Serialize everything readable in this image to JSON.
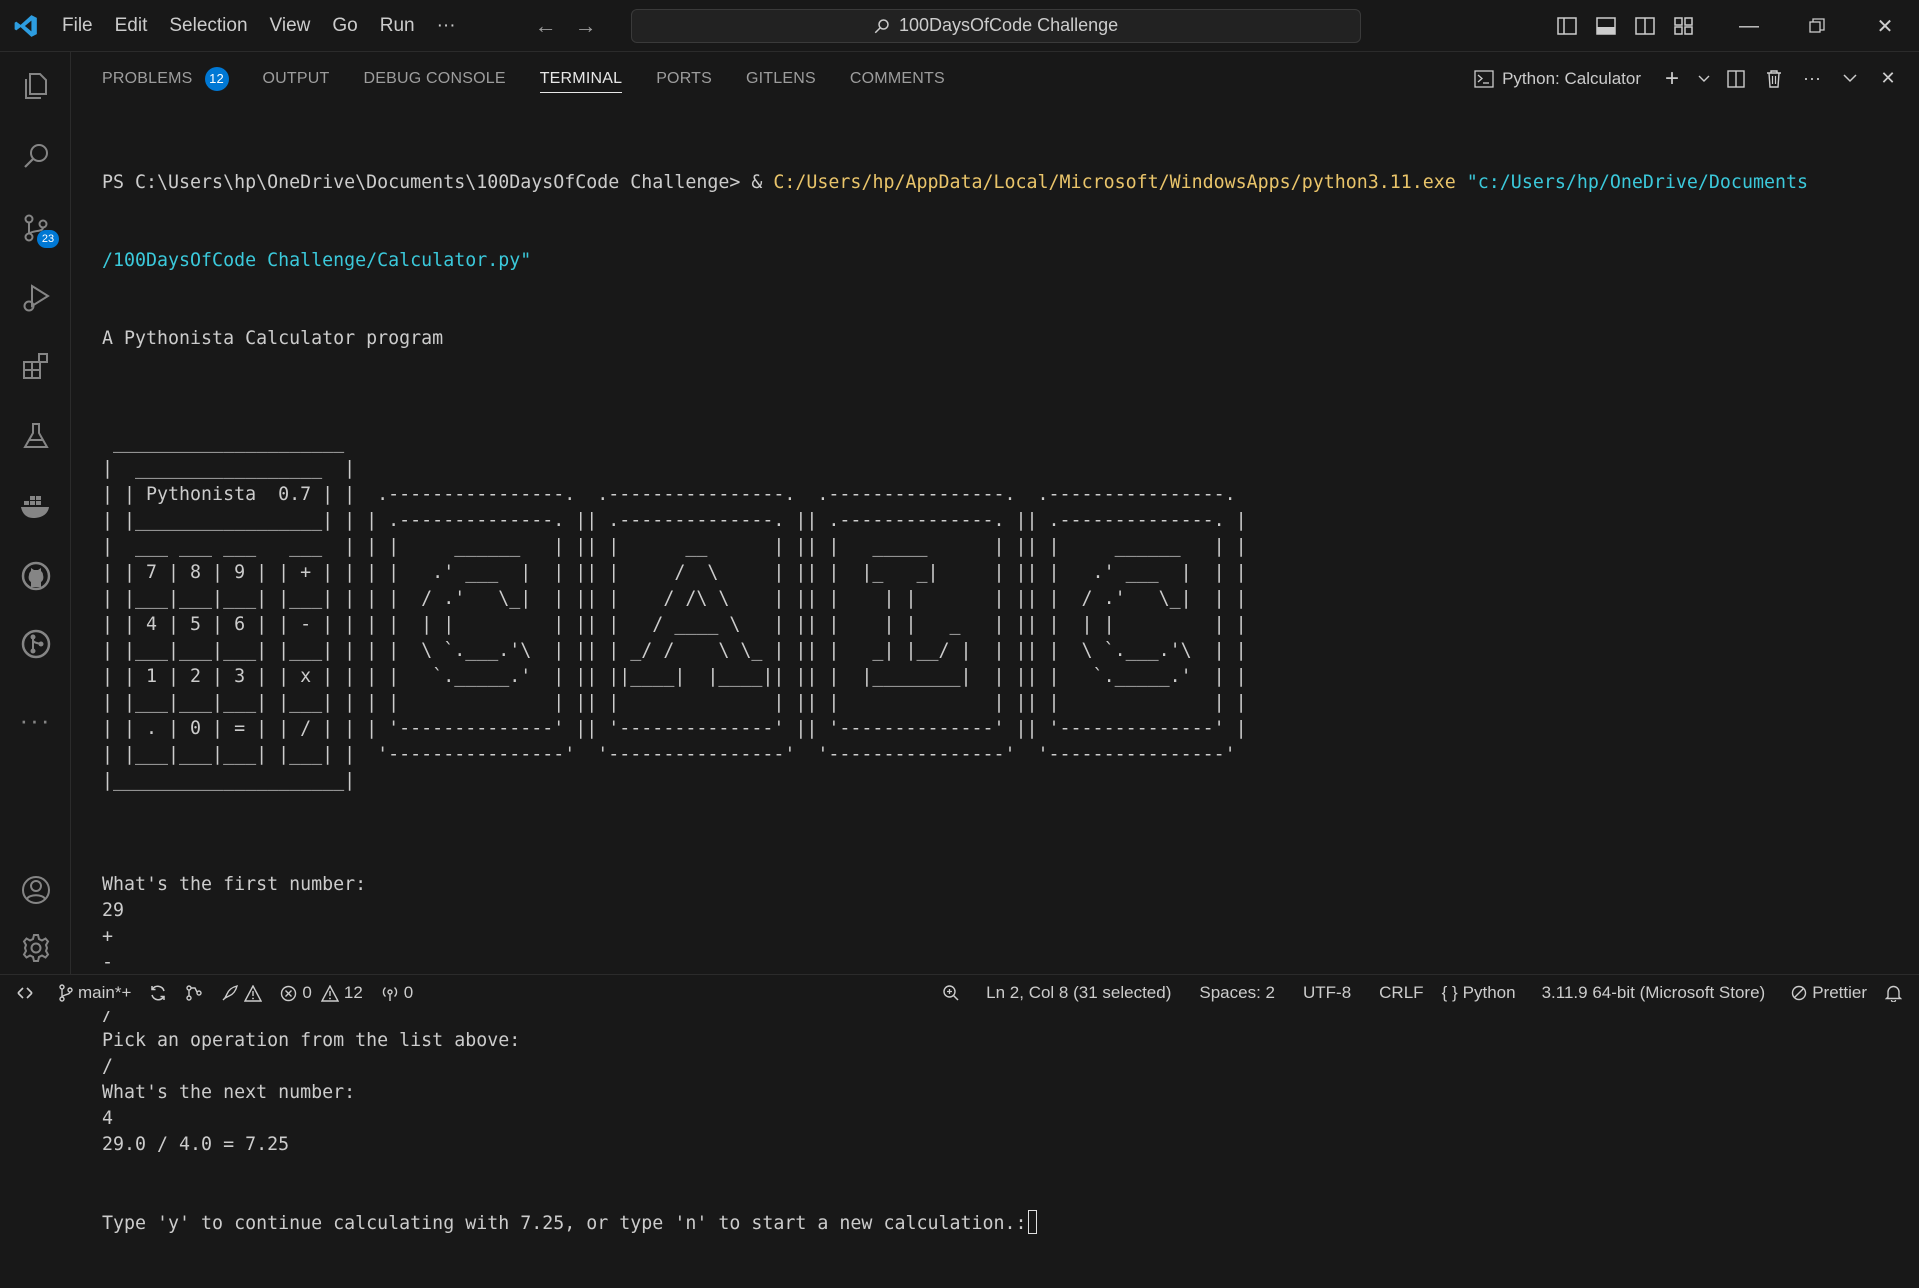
{
  "titlebar": {
    "menu": [
      "File",
      "Edit",
      "Selection",
      "View",
      "Go",
      "Run",
      "···"
    ],
    "search_text": "100DaysOfCode Challenge",
    "icons": [
      "vscode-logo-icon",
      "back-arrow-icon",
      "forward-arrow-icon",
      "search-icon",
      "toggle-primary-sidebar-icon",
      "toggle-panel-icon",
      "toggle-secondary-sidebar-icon",
      "customize-layout-icon",
      "minimize-icon",
      "restore-icon",
      "close-icon"
    ]
  },
  "activitybar": {
    "items": [
      {
        "name": "explorer-icon"
      },
      {
        "name": "search-icon"
      },
      {
        "name": "source-control-icon",
        "badge": "23"
      },
      {
        "name": "run-debug-icon"
      },
      {
        "name": "extensions-icon"
      },
      {
        "name": "testing-icon"
      },
      {
        "name": "docker-icon"
      },
      {
        "name": "github-icon"
      },
      {
        "name": "gitlens-icon"
      },
      {
        "name": "more-icon"
      }
    ],
    "bottom": [
      {
        "name": "accounts-icon"
      },
      {
        "name": "settings-gear-icon"
      }
    ]
  },
  "panel": {
    "tabs": [
      {
        "label": "PROBLEMS",
        "count": "12"
      },
      {
        "label": "OUTPUT"
      },
      {
        "label": "DEBUG CONSOLE"
      },
      {
        "label": "TERMINAL",
        "active": true
      },
      {
        "label": "PORTS"
      },
      {
        "label": "GITLENS"
      },
      {
        "label": "COMMENTS"
      }
    ],
    "terminal_name": "Python: Calculator"
  },
  "terminal": {
    "prompt": "PS C:\\Users\\hp\\OneDrive\\Documents\\100DaysOfCode Challenge> & ",
    "exe": "C:/Users/hp/AppData/Local/Microsoft/WindowsApps/python3.11.exe",
    "arg1": " \"c:/Users/hp/OneDrive/Documents",
    "arg2": "/100DaysOfCode Challenge/Calculator.py\"",
    "banner": "A Pythonista Calculator program",
    "art": [
      "",
      " _____________________",
      "|  _________________  |",
      "| | Pythonista  0.7 | |  .----------------.  .----------------.  .----------------.  .----------------. ",
      "| |_________________| | | .--------------. || .--------------. || .--------------. || .--------------. |",
      "|  ___ ___ ___   ___  | | |     ______   | || |      __      | || |   _____      | || |     ______   | |",
      "| | 7 | 8 | 9 | | + | | | |   .' ___  |  | || |     /  \\     | || |  |_   _|     | || |   .' ___  |  | |",
      "| |___|___|___| |___| | | |  / .'   \\_|  | || |    / /\\ \\    | || |    | |       | || |  / .'   \\_|  | |",
      "| | 4 | 5 | 6 | | - | | | |  | |         | || |   / ____ \\   | || |    | |   _   | || |  | |         | |",
      "| |___|___|___| |___| | | |  \\ `.___.'\\  | || | _/ /    \\ \\_ | || |   _| |__/ |  | || |  \\ `.___.'\\  | |",
      "| | 1 | 2 | 3 | | x | | | |   `._____.'  | || ||____|  |____|| || |  |________|  | || |   `._____.'  | |",
      "| |___|___|___| |___| | | |              | || |              | || |              | || |              | |",
      "| | . | 0 | = | | / | | | '--------------' || '--------------' || '--------------' || '--------------' |",
      "| |___|___|___| |___| |  '----------------'  '----------------'  '----------------'  '----------------' ",
      "|_____________________|",
      ""
    ],
    "session": [
      "What's the first number:",
      "29",
      "+",
      "-",
      "*",
      "/",
      "Pick an operation from the list above:",
      "/",
      "What's the next number:",
      "4",
      "29.0 / 4.0 = 7.25"
    ],
    "last_line": "Type 'y' to continue calculating with 7.25, or type 'n' to start a new calculation.:"
  },
  "statusbar": {
    "branch": "main*+",
    "errors": "0",
    "warnings": "12",
    "ports": "0",
    "position": "Ln 2, Col 8 (31 selected)",
    "spaces": "Spaces: 2",
    "encoding": "UTF-8",
    "eol": "CRLF",
    "language": "Python",
    "interpreter": "3.11.9 64-bit (Microsoft Store)",
    "prettier": "Prettier"
  },
  "colors": {
    "background": "#181818",
    "accent": "#0078d4",
    "path_yellow": "#e9c46a",
    "string_cyan": "#3bc9db"
  }
}
